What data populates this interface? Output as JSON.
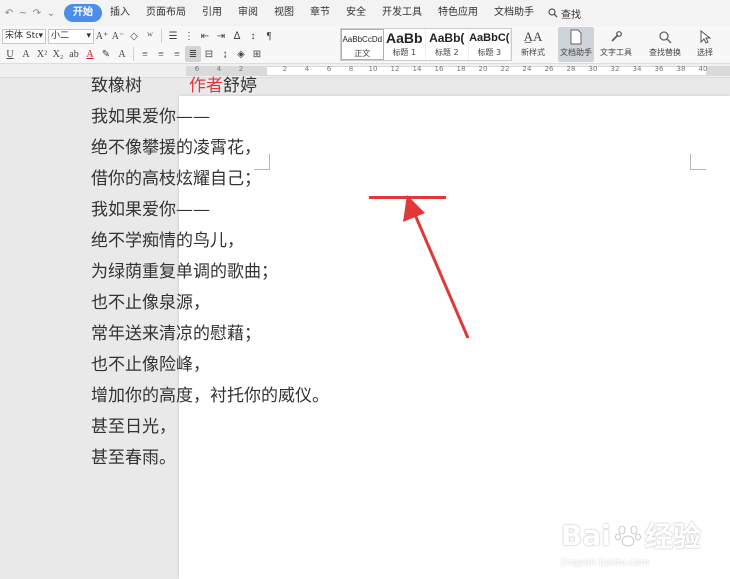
{
  "quick_access": [
    "↶",
    "~",
    "↷",
    "⌄"
  ],
  "menu": {
    "items": [
      "开始",
      "插入",
      "页面布局",
      "引用",
      "审阅",
      "视图",
      "章节",
      "安全",
      "开发工具",
      "特色应用",
      "文档助手"
    ],
    "active": "开始",
    "search_label": "查找"
  },
  "ribbon": {
    "font_name": "宋体 Std L",
    "font_size": "小二",
    "styles": [
      {
        "sample": "AaBbCcDd",
        "name": "正文"
      },
      {
        "sample": "AaBb",
        "name": "标题 1"
      },
      {
        "sample": "AaBb(",
        "name": "标题 2"
      },
      {
        "sample": "AaBbC(",
        "name": "标题 3"
      }
    ],
    "new_style_label": "新样式",
    "doc_helper_label": "文档助手",
    "text_tools_label": "文字工具",
    "find_replace_label": "查找替换",
    "select_label": "选择"
  },
  "ruler": {
    "numbers": [
      "6",
      "4",
      "2",
      "",
      "2",
      "4",
      "6",
      "8",
      "10",
      "12",
      "14",
      "16",
      "18",
      "20",
      "22",
      "24",
      "26",
      "28",
      "30",
      "32",
      "34",
      "36",
      "38",
      "40"
    ]
  },
  "document": {
    "title": "致橡树",
    "author_label": "作者",
    "author_name": "舒婷",
    "lines": [
      "我如果爱你——",
      "绝不像攀援的凌霄花，",
      "借你的高枝炫耀自己；",
      "我如果爱你——",
      "绝不学痴情的鸟儿，",
      "为绿荫重复单调的歌曲；",
      "也不止像泉源，",
      "常年送来清凉的慰藉；",
      "也不止像险峰，",
      "增加你的高度，衬托你的威仪。",
      "甚至日光，",
      "甚至春雨。"
    ]
  },
  "annotation": {
    "color": "#e03838"
  },
  "watermark": {
    "brand": "Bai",
    "brand_tail": "经验",
    "url": "jingyan.baidu.com"
  }
}
